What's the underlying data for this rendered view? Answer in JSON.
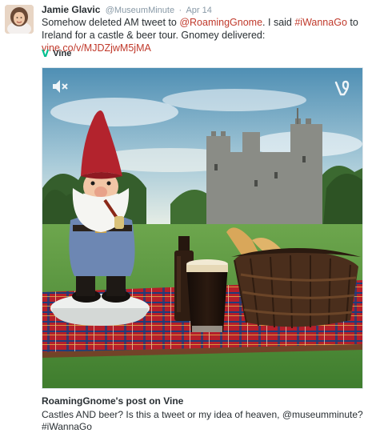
{
  "tweet": {
    "author_name": "Jamie Glavic",
    "author_handle": "@MuseumMinute",
    "separator": "·",
    "timestamp": "Apr 14",
    "text_1": "Somehow deleted AM tweet to ",
    "mention": "@RoamingGnome",
    "text_2": ". I said ",
    "hashtag": "#iWannaGo",
    "text_3": " to Ireland for a castle & beer tour. Gnomey delivered: ",
    "link": "vine.co/v/MJDZjwM5jMA"
  },
  "card": {
    "source_icon": "vine-icon",
    "source_glyph": "V",
    "source_label": "Vine",
    "video_icons": [
      "mute-icon",
      "vine-logo-icon"
    ],
    "title": "RoamingGnome's post on Vine",
    "description": "Castles AND beer? Is this a tweet or my idea of heaven, @museumminute? #iWannaGo"
  },
  "colors": {
    "link": "#c0392b",
    "vine_green": "#00bf8f",
    "muted": "#8899a6"
  }
}
